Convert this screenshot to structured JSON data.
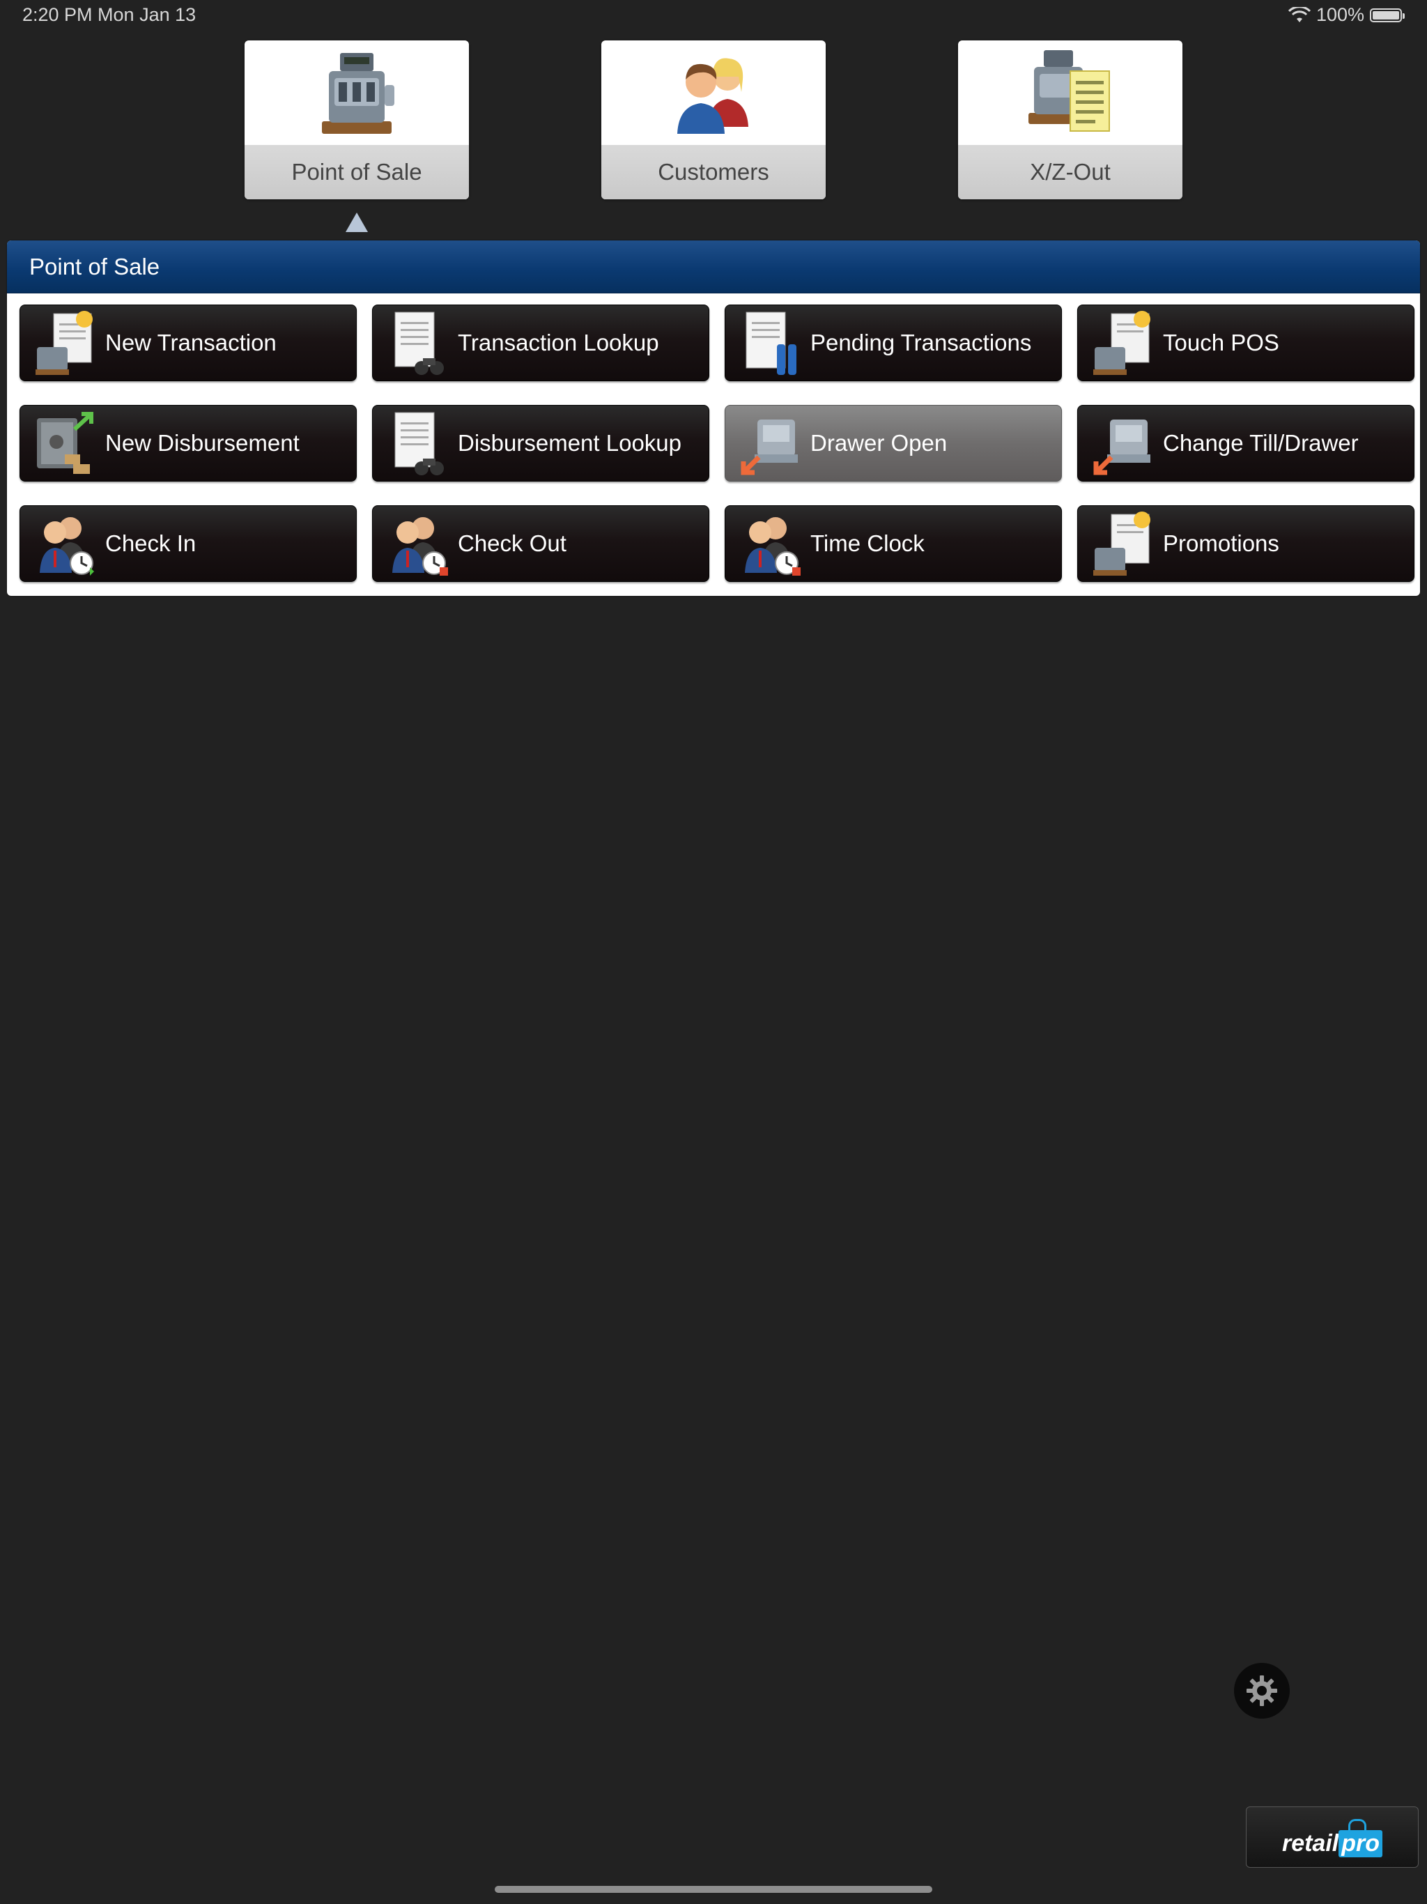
{
  "status_bar": {
    "time": "2:20 PM   Mon Jan 13",
    "battery": "100%"
  },
  "modules": [
    {
      "label": "Point of Sale",
      "icon": "cash-register-icon"
    },
    {
      "label": "Customers",
      "icon": "customers-icon"
    },
    {
      "label": "X/Z-Out",
      "icon": "cash-register-report-icon"
    }
  ],
  "panel": {
    "title": "Point of Sale",
    "buttons": [
      {
        "label": "New Transaction",
        "icon": "new-transaction-icon"
      },
      {
        "label": "Transaction Lookup",
        "icon": "document-binoculars-icon"
      },
      {
        "label": "Pending Transactions",
        "icon": "pending-document-icon"
      },
      {
        "label": "Touch POS",
        "icon": "touch-pos-icon"
      },
      {
        "label": "New Disbursement",
        "icon": "safe-icon"
      },
      {
        "label": "Disbursement Lookup",
        "icon": "document-binoculars-icon"
      },
      {
        "label": "Drawer Open",
        "icon": "drawer-open-icon"
      },
      {
        "label": "Change Till/Drawer",
        "icon": "change-drawer-icon"
      },
      {
        "label": "Check In",
        "icon": "check-in-icon"
      },
      {
        "label": "Check Out",
        "icon": "check-out-icon"
      },
      {
        "label": "Time Clock",
        "icon": "time-clock-icon"
      },
      {
        "label": "Promotions",
        "icon": "promotions-icon"
      }
    ]
  },
  "logo": {
    "part1": "retail",
    "part2": "pro"
  }
}
